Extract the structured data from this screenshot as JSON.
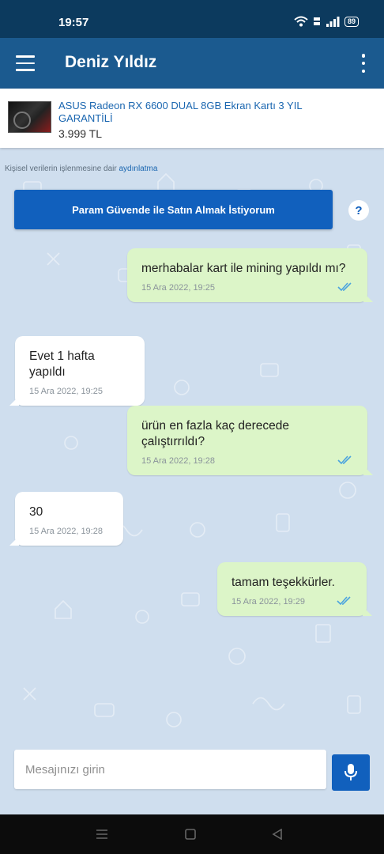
{
  "status_bar": {
    "time": "19:57",
    "battery": "89"
  },
  "header": {
    "title": "Deniz Yıldız",
    "menu_icon": "hamburger-menu-icon",
    "more_icon": "more-vert-icon"
  },
  "product": {
    "name": "ASUS Radeon RX 6600 DUAL 8GB Ekran Kartı 3 YIL GARANTİLİ",
    "price": "3.999 TL"
  },
  "consent": {
    "text": "Kişisel verilerin işlenmesine dair",
    "link": "aydınlatma"
  },
  "safe_purchase_button": "Param Güvende ile Satın Almak İstiyorum",
  "help_label": "?",
  "messages": [
    {
      "direction": "out",
      "text": "merhabalar kart ile mining yapıldı mı?",
      "time": "15 Ara 2022, 19:25",
      "read": true
    },
    {
      "direction": "in",
      "text": "Evet 1 hafta yapıldı",
      "time": "15 Ara 2022, 19:25"
    },
    {
      "direction": "out",
      "text": "ürün en fazla kaç derecede çalıştırrıldı?",
      "time": "15 Ara 2022, 19:28",
      "read": true
    },
    {
      "direction": "in",
      "text": "30",
      "time": "15 Ara 2022, 19:28"
    },
    {
      "direction": "out",
      "text": "tamam teşekkürler.",
      "time": "15 Ara 2022, 19:29",
      "read": true
    }
  ],
  "composer": {
    "placeholder": "Mesajınızı girin",
    "mic_icon": "microphone-icon"
  },
  "colors": {
    "header": "#1b5a8f",
    "status_bar": "#0c3a5e",
    "accent": "#1160bd",
    "outgoing_bubble": "#dcf5c8",
    "chat_bg": "#cfdeee",
    "read_ticks": "#4aa3df"
  }
}
